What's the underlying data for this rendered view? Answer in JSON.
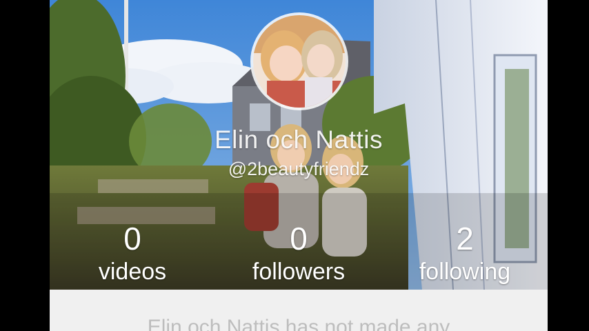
{
  "profile": {
    "display_name": "Elin och Nattis",
    "username": "@2beautyfriendz",
    "avatar": "profile-photo"
  },
  "stats": [
    {
      "key": "videos",
      "value": "0",
      "label": "videos"
    },
    {
      "key": "followers",
      "value": "0",
      "label": "followers"
    },
    {
      "key": "following",
      "value": "2",
      "label": "following"
    }
  ],
  "content": {
    "empty_message": "Elin och Nattis has not made any"
  },
  "colors": {
    "sky": "#4a8fd6",
    "wall": "#e8edf5",
    "grass": "#7a8a3a",
    "empty_text": "#bdbdbd"
  }
}
